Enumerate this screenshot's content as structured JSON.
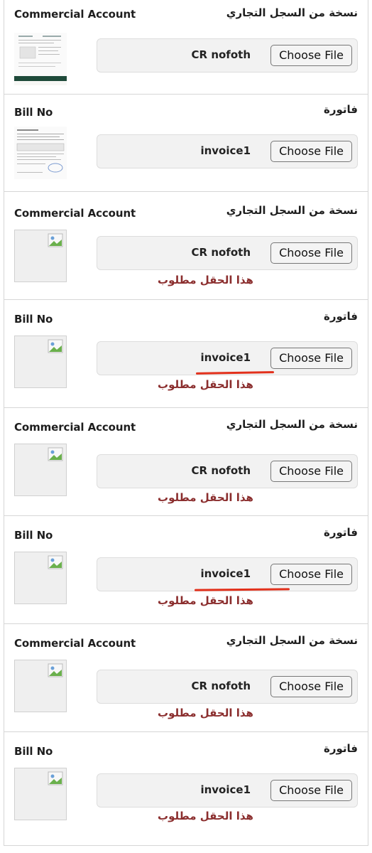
{
  "fields": [
    {
      "label_en": "Commercial Account",
      "label_ar": "نسخة من السجل التجاري",
      "file_name": "CR nofoth",
      "choose_label": "Choose File",
      "error": "",
      "thumb": "doc"
    },
    {
      "label_en": "Bill No",
      "label_ar": "فاتورة",
      "file_name": "invoice1",
      "choose_label": "Choose File",
      "error": "",
      "thumb": "doc"
    },
    {
      "label_en": "Commercial Account",
      "label_ar": "نسخة من السجل التجاري",
      "file_name": "CR nofoth",
      "choose_label": "Choose File",
      "error": "هذا الحقل مطلوب",
      "thumb": "broken-image"
    },
    {
      "label_en": "Bill No",
      "label_ar": "فاتورة",
      "file_name": "invoice1",
      "choose_label": "Choose File",
      "error": "هذا الحقل مطلوب",
      "thumb": "broken-image"
    },
    {
      "label_en": "Commercial Account",
      "label_ar": "نسخة من السجل التجاري",
      "file_name": "CR nofoth",
      "choose_label": "Choose File",
      "error": "هذا الحقل مطلوب",
      "thumb": "broken-image"
    },
    {
      "label_en": "Bill No",
      "label_ar": "فاتورة",
      "file_name": "invoice1",
      "choose_label": "Choose File",
      "error": "هذا الحقل مطلوب",
      "thumb": "broken-image"
    },
    {
      "label_en": "Commercial Account",
      "label_ar": "نسخة من السجل التجاري",
      "file_name": "CR nofoth",
      "choose_label": "Choose File",
      "error": "هذا الحقل مطلوب",
      "thumb": "broken-image"
    },
    {
      "label_en": "Bill No",
      "label_ar": "فاتورة",
      "file_name": "invoice1",
      "choose_label": "Choose File",
      "error": "هذا الحقل مطلوب",
      "thumb": "broken-image"
    }
  ],
  "colors": {
    "error": "#8b2e2e",
    "annotation": "#e2301b",
    "border": "#d6d6d6"
  }
}
